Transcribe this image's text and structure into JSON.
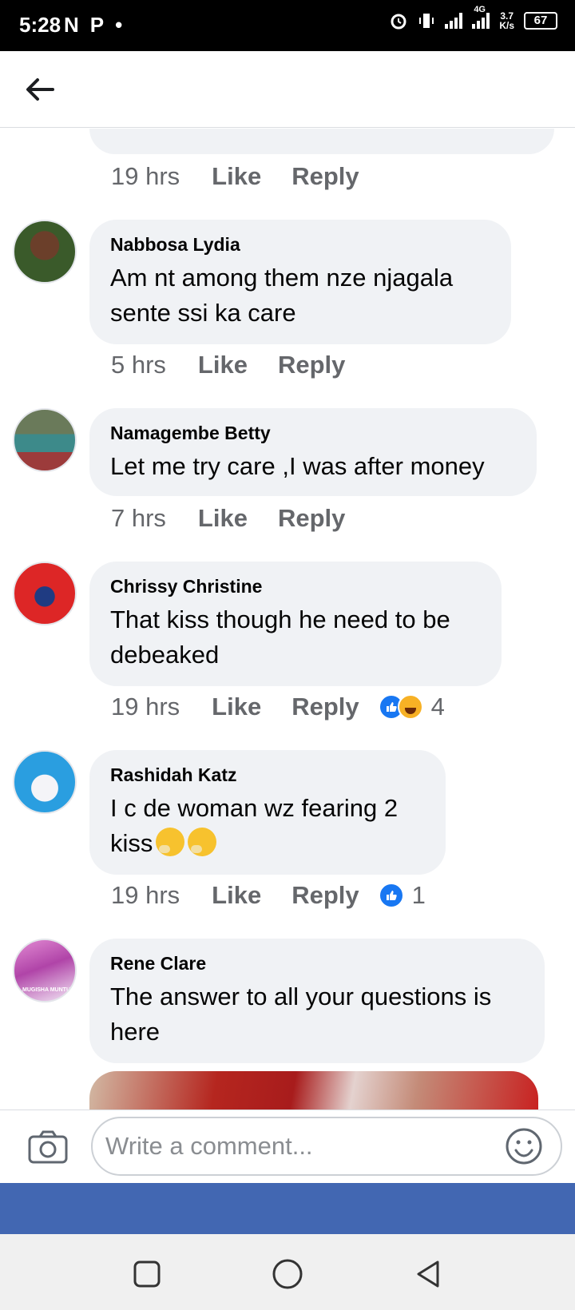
{
  "status_bar": {
    "time": "5:28",
    "left_icons": [
      "N",
      "P",
      "•"
    ],
    "network_type": "4G",
    "net_speed_value": "3.7",
    "net_speed_unit": "K/s",
    "battery": "67"
  },
  "composer": {
    "placeholder": "Write a comment..."
  },
  "previous_comment": {
    "time": "19 hrs",
    "like_label": "Like",
    "reply_label": "Reply"
  },
  "comments": [
    {
      "author": "Nabbosa Lydia",
      "text_lines": [
        "Am nt among them nze njagala",
        "sente ssi ka care"
      ],
      "time": "5 hrs",
      "like_label": "Like",
      "reply_label": "Reply",
      "reaction_count": ""
    },
    {
      "author": "Namagembe Betty",
      "text_lines": [
        "Let me try care ,I was after money"
      ],
      "time": "7 hrs",
      "like_label": "Like",
      "reply_label": "Reply",
      "reaction_count": ""
    },
    {
      "author": "Chrissy Christine",
      "text_lines": [
        "That kiss though he need to be",
        "debeaked"
      ],
      "time": "19 hrs",
      "like_label": "Like",
      "reply_label": "Reply",
      "reaction_count": "4"
    },
    {
      "author": "Rashidah Katz",
      "text_lines": [
        "I c de woman wz fearing 2",
        "kiss"
      ],
      "time": "19 hrs",
      "like_label": "Like",
      "reply_label": "Reply",
      "reaction_count": "1"
    },
    {
      "author": "Rene Clare",
      "text_lines": [
        "The answer to all your questions is",
        "here"
      ],
      "avatar_caption": "MUGISHA MUNTU"
    }
  ],
  "colors": {
    "brand_blue": "#4267b2",
    "like_blue": "#1877f2",
    "bubble_gray": "#f0f2f5",
    "meta_gray": "#65676b"
  },
  "icons": [
    "back-arrow-icon",
    "camera-icon",
    "smiley-icon",
    "like-reaction-icon",
    "haha-reaction-icon",
    "thinking-emoji-icon",
    "square-nav-icon",
    "circle-nav-icon",
    "triangle-back-nav-icon"
  ]
}
